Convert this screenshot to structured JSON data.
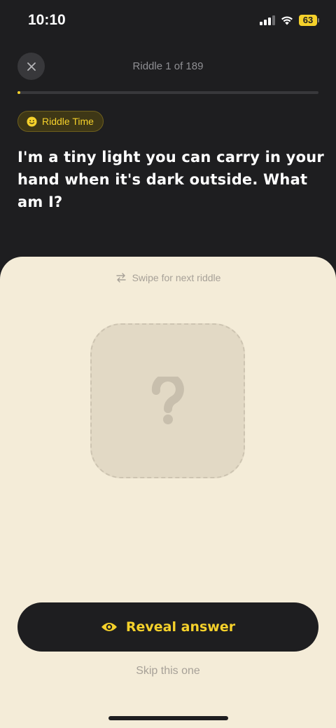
{
  "status_bar": {
    "time": "10:10",
    "battery_level": "63",
    "icons": [
      "cellular-signal-icon",
      "wifi-icon",
      "battery-icon"
    ]
  },
  "header": {
    "progress_label": "Riddle 1 of 189",
    "progress_fraction": 0.0053,
    "close_icon": "close-icon"
  },
  "badge": {
    "label": "Riddle Time",
    "icon": "smiley-icon"
  },
  "riddle": {
    "question": "I'm a tiny light you can carry in your hand when it's dark outside. What am I?"
  },
  "sheet": {
    "swipe_hint": "Swipe for next riddle",
    "swipe_icon": "swap-arrows-icon",
    "placeholder_glyph": "?",
    "reveal_label": "Reveal answer",
    "reveal_icon": "eye-icon",
    "skip_label": "Skip this one"
  },
  "colors": {
    "background": "#1e1e20",
    "accent": "#f5d12b",
    "sheet": "#f4ecd8",
    "muted_text": "#a7a198"
  }
}
